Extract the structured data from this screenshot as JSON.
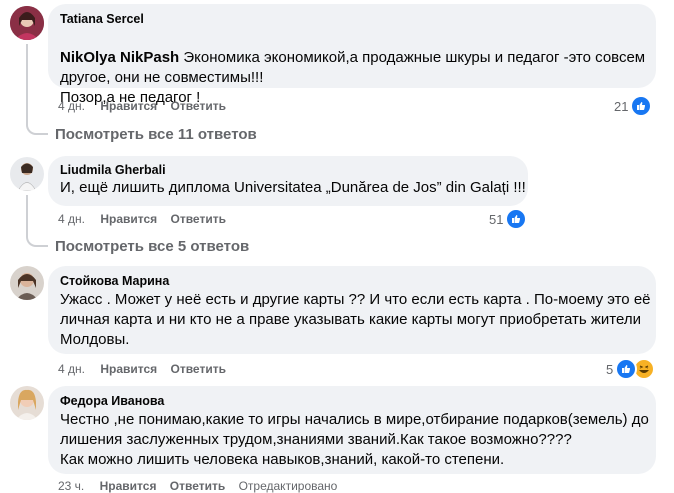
{
  "comments": [
    {
      "author": "Tatiana Sercel",
      "mention": "NikOlya NikPash",
      "text": " Экономика экономикой,а продажные шкуры и педагог -это совсем другое, они не совместимы!!!\nПозор,а не педагог !",
      "time": "4 дн.",
      "like": "Нравится",
      "reply": "Ответить",
      "reactions": "21",
      "view_replies": "Посмотреть все 11 ответов"
    },
    {
      "author": "Liudmila Gherbali",
      "text": "И, ещё лишить диплома Universitatea „Dunărea de Jos” din Galați !!!",
      "time": "4 дн.",
      "like": "Нравится",
      "reply": "Ответить",
      "reactions": "51",
      "view_replies": "Посмотреть все 5 ответов"
    },
    {
      "author": "Стойкова Марина",
      "text": "Ужасс . Может у неё есть и другие карты ?? И что если есть карта . По-моему это её личная карта и ни кто не а праве указывать какие карты могут приобретать жители Молдовы.",
      "time": "4 дн.",
      "like": "Нравится",
      "reply": "Ответить",
      "reactions": "5"
    },
    {
      "author": "Федора Иванова",
      "text": "Честно ,не понимаю,какие то игры начались в мире,отбирание подарков(земель) до лишения заслуженных трудом,знаниями званий.Как такое возможно????\nКак можно лишить человека навыков,знаний, какой-то степени.",
      "time": "23 ч.",
      "like": "Нравится",
      "reply": "Ответить",
      "edited": "Отредактировано"
    }
  ],
  "colors": {
    "bubble": "#f0f2f5",
    "like": "#1877f2",
    "meta": "#65676b"
  }
}
